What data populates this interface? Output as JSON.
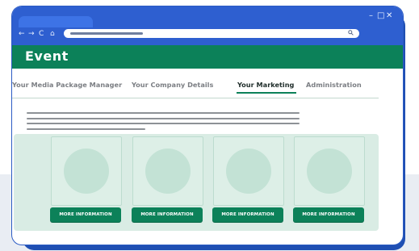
{
  "window": {
    "controls": [
      "–",
      "□",
      "✕"
    ]
  },
  "toolbar": {
    "back_icon": "←",
    "forward_icon": "→",
    "reload_icon": "C",
    "home_icon": "⌂",
    "search_icon": "search-icon"
  },
  "header": {
    "title": "Event"
  },
  "tabs": [
    {
      "label": "Your Media Package Manager"
    },
    {
      "label": "Your Company Details"
    },
    {
      "label": "Your Marketing"
    },
    {
      "label": "Administration"
    }
  ],
  "cards": [
    {
      "button_label": "MORE INFORMATION"
    },
    {
      "button_label": "MORE INFORMATION"
    },
    {
      "button_label": "MORE INFORMATION"
    },
    {
      "button_label": "MORE INFORMATION"
    }
  ],
  "colors": {
    "brand_green": "#0c8159",
    "browser_blue": "#2e5fd0",
    "card_fill": "#ddefe7"
  }
}
